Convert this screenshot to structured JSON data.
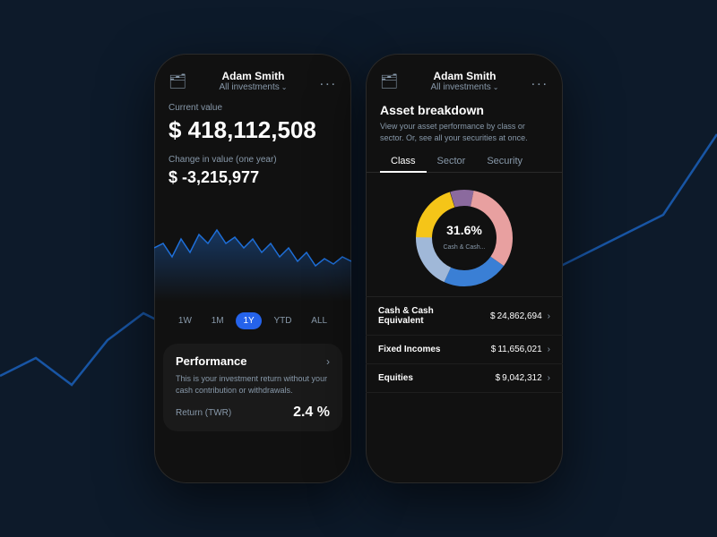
{
  "background": {
    "color": "#0d1a2a"
  },
  "left_phone": {
    "header": {
      "name": "Adam Smith",
      "sub_label": "All investments",
      "icon": "📁",
      "more": "..."
    },
    "current_value_label": "Current value",
    "current_value": "$ 418,112,508",
    "change_label": "Change in value (one year)",
    "change_value": "$ -3,215,977",
    "time_periods": [
      "1W",
      "1M",
      "1Y",
      "YTD",
      "ALL"
    ],
    "active_period": "1Y",
    "performance": {
      "title": "Performance",
      "description": "This is your investment return without your cash contribution or withdrawals.",
      "return_label": "Return  (TWR)",
      "return_value": "2.4 %"
    }
  },
  "right_phone": {
    "header": {
      "name": "Adam Smith",
      "sub_label": "All investments",
      "icon": "📁",
      "more": "..."
    },
    "asset_breakdown_title": "Asset breakdown",
    "asset_breakdown_desc": "View your asset performance by class or sector. Or, see all your securities at once.",
    "tabs": [
      "Class",
      "Sector",
      "Security"
    ],
    "active_tab": "Class",
    "donut": {
      "percent": "31.6%",
      "label": "Cash & Cash...",
      "segments": [
        {
          "color": "#f5c518",
          "value": 20
        },
        {
          "color": "#8b6a9e",
          "value": 8
        },
        {
          "color": "#e8a0a0",
          "value": 31.6
        },
        {
          "color": "#3a7fd5",
          "value": 22
        },
        {
          "color": "#a0b8d8",
          "value": 18.4
        }
      ]
    },
    "assets": [
      {
        "name": "Cash & Cash\nEquivalent",
        "value": "$ 24,862,694"
      },
      {
        "name": "Fixed Incomes",
        "value": "$ 11,656,021"
      },
      {
        "name": "Equities",
        "value": "$ 9,042,312"
      }
    ]
  }
}
